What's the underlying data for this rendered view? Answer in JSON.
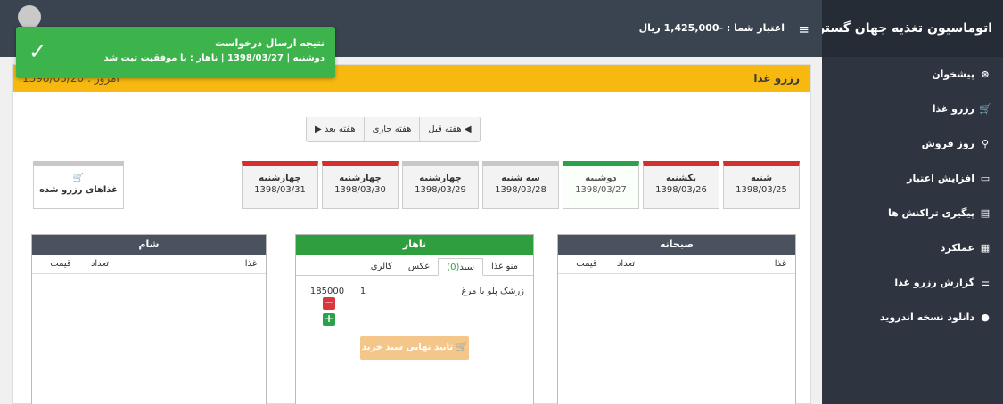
{
  "brand": "اتوماسیون تغذیه جهان گستر",
  "sidebar": {
    "items": [
      {
        "label": "پیشخوان",
        "icon": "dashboard-icon",
        "glyph": "⊛"
      },
      {
        "label": "رزرو غذا",
        "icon": "cart-icon",
        "glyph": "🛒"
      },
      {
        "label": "روز فروش",
        "icon": "person-icon",
        "glyph": "⚲"
      },
      {
        "label": "افزایش اعتبار",
        "icon": "card-icon",
        "glyph": "▭"
      },
      {
        "label": "پیگیری تراکنش ها",
        "icon": "file-icon",
        "glyph": "▤"
      },
      {
        "label": "عملکرد",
        "icon": "table-icon",
        "glyph": "▦"
      },
      {
        "label": "گزارش رزرو غذا",
        "icon": "list-icon",
        "glyph": "☰"
      },
      {
        "label": "دانلود نسخه اندروید",
        "icon": "android-icon",
        "glyph": "●"
      }
    ]
  },
  "topbar": {
    "menu_glyph": "≡",
    "credit": "اعتبار شما : -1,425,000 ریال"
  },
  "panel": {
    "title": "رزرو غذا",
    "today": "امروز : 1398/03/20"
  },
  "weeknav": {
    "prev": "◀ هفته قبل",
    "current": "هفته جاری",
    "next": "هفته بعد ▶"
  },
  "days": [
    {
      "name": "شنبه",
      "date": "1398/03/25",
      "status": "red"
    },
    {
      "name": "یکشنبه",
      "date": "1398/03/26",
      "status": "red"
    },
    {
      "name": "دوشنبه",
      "date": "1398/03/27",
      "status": "green"
    },
    {
      "name": "سه شنبه",
      "date": "1398/03/28",
      "status": "gray"
    },
    {
      "name": "چهارشنبه",
      "date": "1398/03/29",
      "status": "gray"
    },
    {
      "name": "چهارشنبه",
      "date": "1398/03/30",
      "status": "red"
    },
    {
      "name": "چهارشنبه",
      "date": "1398/03/31",
      "status": "red"
    }
  ],
  "reserved": {
    "icon_glyph": "🛒",
    "label": "غذاهای رزرو شده"
  },
  "meals": {
    "breakfast": {
      "title": "صبحانه",
      "cols": [
        "غذا",
        "تعداد",
        "قیمت"
      ]
    },
    "lunch": {
      "title": "ناهار",
      "tabs": [
        "منو غذا",
        "سبد",
        "عکس",
        "کالری"
      ],
      "basket_count": "(0)",
      "order": {
        "name": "زرشک پلو با مرغ",
        "qty": "1",
        "price": "185000"
      },
      "minus": "−",
      "plus": "+",
      "confirm": "🛒 تایید نهایی سبد خرید"
    },
    "dinner": {
      "title": "شام",
      "cols": [
        "غذا",
        "تعداد",
        "قیمت"
      ]
    }
  },
  "toast": {
    "title": "نتیجه ارسال درخواست",
    "message": "دوشنبه | 1398/03/27 | ناهار : با موفقیت ثبت شد",
    "check": "✓"
  }
}
